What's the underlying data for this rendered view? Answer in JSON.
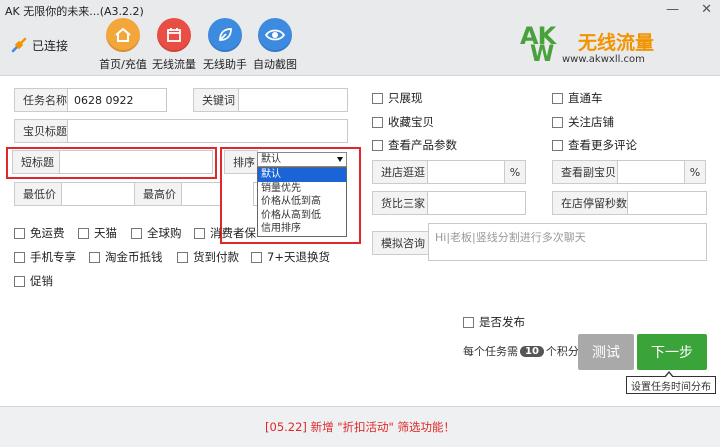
{
  "window": {
    "title": "AK 无限你的未来...(A3.2.2)",
    "min": "—",
    "close": "✕"
  },
  "header": {
    "status": "已连接",
    "nav": [
      {
        "label": "首页/充值",
        "icon": "home-icon",
        "color": "#f3a63a"
      },
      {
        "label": "无线流量",
        "icon": "calendar-icon",
        "color": "#e94e45"
      },
      {
        "label": "无线助手",
        "icon": "leaf-icon",
        "color": "#3c8be0"
      },
      {
        "label": "自动截图",
        "icon": "eye-icon",
        "color": "#3c8be0"
      }
    ],
    "logo": {
      "ak": "AK",
      "w": "W",
      "name": "无线流量",
      "url": "www.akwxll.com"
    }
  },
  "form": {
    "task_name_label": "任务名称",
    "task_name_value": "0628 0922",
    "keyword_label": "关键词",
    "keyword_value": "",
    "item_title_label": "宝贝标题",
    "short_title_label": "短标题",
    "sort_label": "排序",
    "sort_selected": "默认",
    "sort_options": [
      "默认",
      "销量优先",
      "价格从低到高",
      "价格从高到低",
      "信用排序"
    ],
    "min_price_label": "最低价",
    "max_price_label": "最高价",
    "checkboxes_row1": [
      "免运费",
      "天猫",
      "全球购",
      "消费者保"
    ],
    "checkboxes_row2": [
      "手机专享",
      "淘金币抵钱",
      "货到付款",
      "7+天退换货"
    ],
    "checkboxes_row3": [
      "促销"
    ]
  },
  "right": {
    "checks": [
      "只展现",
      "直通车",
      "收藏宝贝",
      "关注店铺",
      "查看产品参数",
      "查看更多评论"
    ],
    "shop_stay_label": "进店逛逛",
    "view_sub_label": "查看副宝贝",
    "percent": "%",
    "compare_label": "货比三家",
    "stay_seconds_label": "在店停留秒数",
    "chat_label": "模拟咨询",
    "chat_placeholder": "Hi|老板|竖线分割进行多次聊天"
  },
  "actions": {
    "publish_label": "是否发布",
    "points_prefix": "每个任务需",
    "points_value": "10",
    "points_suffix": "个积分",
    "test_label": "测试",
    "next_label": "下一步",
    "tooltip": "设置任务时间分布"
  },
  "footer": {
    "notice": "[05.22] 新增 \"折扣活动\" 筛选功能！"
  }
}
